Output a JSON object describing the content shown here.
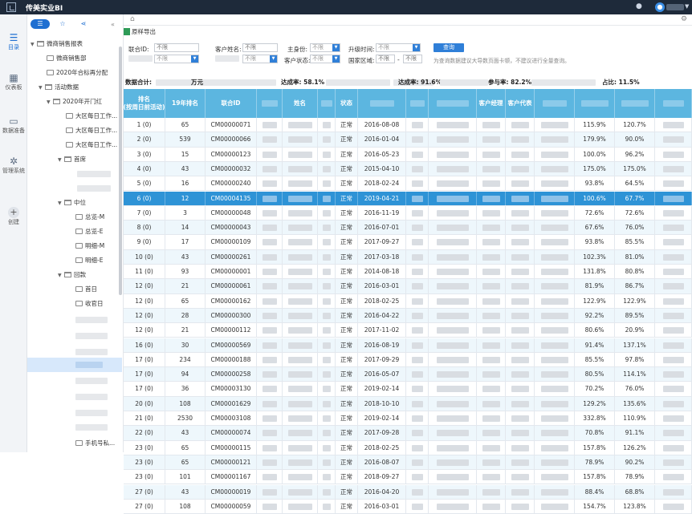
{
  "app": {
    "title": "传美实业BI"
  },
  "iconbar": {
    "items": [
      {
        "label": "目录",
        "icon": "catalog-icon"
      },
      {
        "label": "仪表板",
        "icon": "dashboard-icon"
      },
      {
        "label": "数据准备",
        "icon": "data-prep-icon"
      },
      {
        "label": "管理系统",
        "icon": "gear-icon"
      },
      {
        "label": "创建",
        "icon": "plus-icon"
      }
    ]
  },
  "tree": {
    "nodes": [
      {
        "label": "微商销售报表"
      },
      {
        "label": "微商销售部"
      },
      {
        "label": "2020年合标再分配"
      },
      {
        "label": "活动数据"
      },
      {
        "label": "2020年开门红"
      },
      {
        "label": "大区每日工作..."
      },
      {
        "label": "大区每日工作..."
      },
      {
        "label": "大区每日工作..."
      },
      {
        "label": "首席"
      },
      {
        "label": "中位"
      },
      {
        "label": "总览-M"
      },
      {
        "label": "总览-E"
      },
      {
        "label": "明细-M"
      },
      {
        "label": "明细-E"
      },
      {
        "label": "回款"
      },
      {
        "label": "首日"
      },
      {
        "label": "收官日"
      },
      {
        "label": "手机号私..."
      }
    ]
  },
  "toolbar": {
    "export_label": "原样导出"
  },
  "filters": {
    "coop_id_label": "联合ID:",
    "coop_id_placeholder": "不限",
    "customer_name_label": "客户姓名:",
    "customer_name_placeholder": "不限",
    "identity_label": "主身份:",
    "identity_value": "不限",
    "upgrade_time_label": "升级时间:",
    "upgrade_time_value": "不限",
    "row2_select_value": "不限",
    "row2_select2_value": "不限",
    "row2_input_value": "不限",
    "customer_status_label": "客户状态:",
    "customer_status_value": "不限",
    "nation_region_label": "国家区域:",
    "nation_region_value": "不限",
    "nation_region_value2": "不限",
    "range_sep": "-",
    "query_button": "查询",
    "hint": "为查询数据建议大导数页面卡顿，不建议进行全量查询。"
  },
  "summary": {
    "total_label": "数据合计:",
    "unit": "万元",
    "rate1": "达成率: 58.1%",
    "rate2": "达成率: 91.6%",
    "participation": "参与率: 82.2%",
    "ratio": "占比: 11.5%"
  },
  "table": {
    "headers": [
      "排名\n(按周日前活动)",
      "19年排名",
      "联合ID",
      "",
      "姓名",
      "",
      "状态",
      "",
      "",
      "",
      "客户经理",
      "客户代表",
      "",
      "",
      ""
    ],
    "rows": [
      {
        "rank": "1 (0)",
        "rank19": "65",
        "id": "CM00000071",
        "status": "正常",
        "date": "2016-08-08",
        "p1": "115.9%",
        "p2": "120.7%"
      },
      {
        "rank": "2 (0)",
        "rank19": "539",
        "id": "CM00000066",
        "status": "正常",
        "date": "2016-01-04",
        "p1": "179.9%",
        "p2": "90.0%"
      },
      {
        "rank": "3 (0)",
        "rank19": "15",
        "id": "CM00000123",
        "status": "正常",
        "date": "2016-05-23",
        "p1": "100.0%",
        "p2": "96.2%"
      },
      {
        "rank": "4 (0)",
        "rank19": "43",
        "id": "CM00000032",
        "status": "正常",
        "date": "2015-04-10",
        "p1": "175.0%",
        "p2": "175.0%"
      },
      {
        "rank": "5 (0)",
        "rank19": "16",
        "id": "CM00000240",
        "status": "正常",
        "date": "2018-02-24",
        "p1": "93.8%",
        "p2": "64.5%"
      },
      {
        "rank": "6 (0)",
        "rank19": "12",
        "id": "CM00004135",
        "status": "正常",
        "date": "2019-04-21",
        "p1": "100.6%",
        "p2": "67.7%"
      },
      {
        "rank": "7 (0)",
        "rank19": "3",
        "id": "CM00000048",
        "status": "正常",
        "date": "2016-11-19",
        "p1": "72.6%",
        "p2": "72.6%"
      },
      {
        "rank": "8 (0)",
        "rank19": "14",
        "id": "CM00000043",
        "status": "正常",
        "date": "2016-07-01",
        "p1": "67.6%",
        "p2": "76.0%"
      },
      {
        "rank": "9 (0)",
        "rank19": "17",
        "id": "CM00000109",
        "status": "正常",
        "date": "2017-09-27",
        "p1": "93.8%",
        "p2": "85.5%"
      },
      {
        "rank": "10 (0)",
        "rank19": "43",
        "id": "CM00000261",
        "status": "正常",
        "date": "2017-03-18",
        "p1": "102.3%",
        "p2": "81.0%"
      },
      {
        "rank": "11 (0)",
        "rank19": "93",
        "id": "CM00000001",
        "status": "正常",
        "date": "2014-08-18",
        "p1": "131.8%",
        "p2": "80.8%"
      },
      {
        "rank": "12 (0)",
        "rank19": "21",
        "id": "CM00000061",
        "status": "正常",
        "date": "2016-03-01",
        "p1": "81.9%",
        "p2": "86.7%"
      },
      {
        "rank": "12 (0)",
        "rank19": "65",
        "id": "CM00000162",
        "status": "正常",
        "date": "2018-02-25",
        "p1": "122.9%",
        "p2": "122.9%"
      },
      {
        "rank": "12 (0)",
        "rank19": "28",
        "id": "CM00000300",
        "status": "正常",
        "date": "2016-04-22",
        "p1": "92.2%",
        "p2": "89.5%"
      },
      {
        "rank": "12 (0)",
        "rank19": "21",
        "id": "CM00000112",
        "status": "正常",
        "date": "2017-11-02",
        "p1": "80.6%",
        "p2": "20.9%"
      },
      {
        "rank": "16 (0)",
        "rank19": "30",
        "id": "CM00000569",
        "status": "正常",
        "date": "2016-08-19",
        "p1": "91.4%",
        "p2": "137.1%"
      },
      {
        "rank": "17 (0)",
        "rank19": "234",
        "id": "CM00000188",
        "status": "正常",
        "date": "2017-09-29",
        "p1": "85.5%",
        "p2": "97.8%"
      },
      {
        "rank": "17 (0)",
        "rank19": "94",
        "id": "CM00000258",
        "status": "正常",
        "date": "2016-05-07",
        "p1": "80.5%",
        "p2": "114.1%"
      },
      {
        "rank": "17 (0)",
        "rank19": "36",
        "id": "CM00003130",
        "status": "正常",
        "date": "2019-02-14",
        "p1": "70.2%",
        "p2": "76.0%"
      },
      {
        "rank": "20 (0)",
        "rank19": "108",
        "id": "CM00001629",
        "status": "正常",
        "date": "2018-10-10",
        "p1": "129.2%",
        "p2": "135.6%"
      },
      {
        "rank": "21 (0)",
        "rank19": "2530",
        "id": "CM00003108",
        "status": "正常",
        "date": "2019-02-14",
        "p1": "332.8%",
        "p2": "110.9%"
      },
      {
        "rank": "22 (0)",
        "rank19": "43",
        "id": "CM00000074",
        "status": "正常",
        "date": "2017-09-28",
        "p1": "70.8%",
        "p2": "91.1%"
      },
      {
        "rank": "23 (0)",
        "rank19": "65",
        "id": "CM00000115",
        "status": "正常",
        "date": "2018-02-25",
        "p1": "157.8%",
        "p2": "126.2%"
      },
      {
        "rank": "23 (0)",
        "rank19": "65",
        "id": "CM00000121",
        "status": "正常",
        "date": "2016-08-07",
        "p1": "78.9%",
        "p2": "90.2%"
      },
      {
        "rank": "23 (0)",
        "rank19": "101",
        "id": "CM00001167",
        "status": "正常",
        "date": "2018-09-27",
        "p1": "157.8%",
        "p2": "78.9%"
      },
      {
        "rank": "27 (0)",
        "rank19": "43",
        "id": "CM00000019",
        "status": "正常",
        "date": "2016-04-20",
        "p1": "88.4%",
        "p2": "68.8%"
      },
      {
        "rank": "27 (0)",
        "rank19": "108",
        "id": "CM00000059",
        "status": "正常",
        "date": "2016-03-01",
        "p1": "154.7%",
        "p2": "123.8%"
      }
    ]
  }
}
